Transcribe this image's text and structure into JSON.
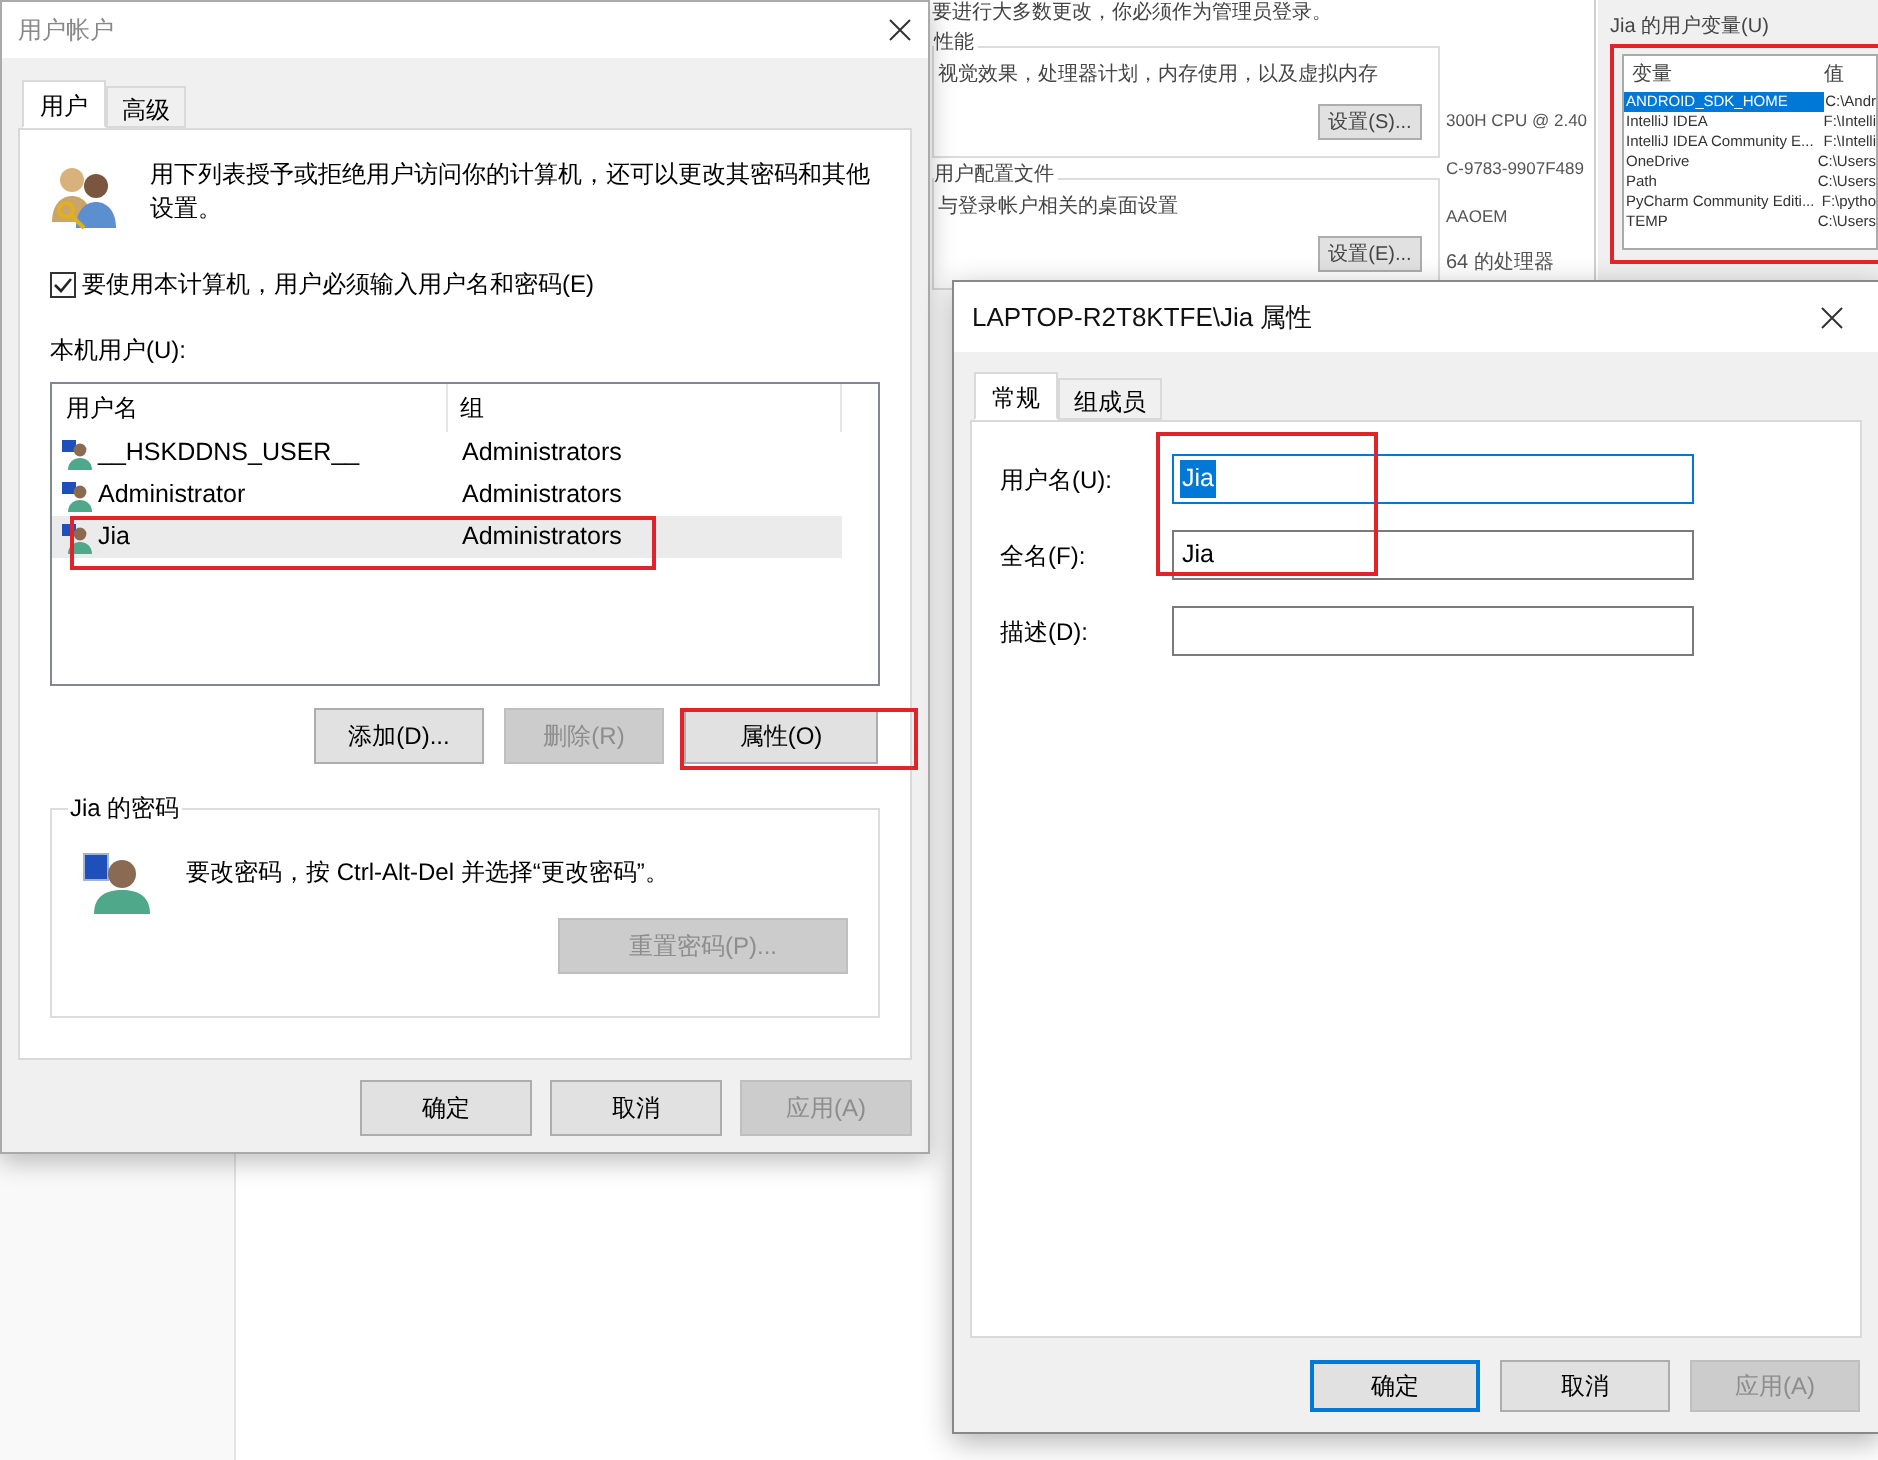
{
  "background": {
    "system_properties": {
      "notice": "要进行大多数更改，你必须作为管理员登录。",
      "performance": {
        "title": "性能",
        "text": "视觉效果，处理器计划，内存使用，以及虚拟内存",
        "button": "设置(S)..."
      },
      "profiles": {
        "title": "用户配置文件",
        "text": "与登录帐户相关的桌面设置",
        "button": "设置(E)..."
      }
    },
    "system_info": [
      "300H CPU @ 2.40",
      "C-9783-9907F489",
      "AAOEM",
      "64 的处理器"
    ],
    "env_vars": {
      "title": "Jia 的用户变量(U)",
      "columns": [
        "变量",
        "值"
      ],
      "rows": [
        {
          "name": "ANDROID_SDK_HOME",
          "value": "C:\\Andr",
          "selected": true
        },
        {
          "name": "IntelliJ IDEA",
          "value": "F:\\Intelli",
          "selected": false
        },
        {
          "name": "IntelliJ IDEA Community E...",
          "value": "F:\\Intelli",
          "selected": false
        },
        {
          "name": "OneDrive",
          "value": "C:\\Users",
          "selected": false
        },
        {
          "name": "Path",
          "value": "C:\\Users",
          "selected": false
        },
        {
          "name": "PyCharm Community Editi...",
          "value": "F:\\pytho",
          "selected": false
        },
        {
          "name": "TEMP",
          "value": "C:\\Users",
          "selected": false
        }
      ]
    }
  },
  "accounts_dialog": {
    "title": "用户帐户",
    "tabs": [
      {
        "label": "用户",
        "selected": true
      },
      {
        "label": "高级",
        "selected": false
      }
    ],
    "intro": "用下列表授予或拒绝用户访问你的计算机，还可以更改其密码和其他设置。",
    "require_password": {
      "label": "要使用本计算机，用户必须输入用户名和密码(E)",
      "checked": true
    },
    "users_label": "本机用户(U):",
    "users_table": {
      "columns": [
        "用户名",
        "组"
      ],
      "rows": [
        {
          "name": "__HSKDDNS_USER__",
          "group": "Administrators",
          "selected": false
        },
        {
          "name": "Administrator",
          "group": "Administrators",
          "selected": false
        },
        {
          "name": "Jia",
          "group": "Administrators",
          "selected": true
        }
      ]
    },
    "buttons": [
      {
        "label": "添加(D)...",
        "disabled": false
      },
      {
        "label": "删除(R)",
        "disabled": true
      },
      {
        "label": "属性(O)",
        "disabled": false
      }
    ],
    "password_group": {
      "title": "Jia 的密码",
      "text": "要改密码，按 Ctrl-Alt-Del 并选择“更改密码”。",
      "button": {
        "label": "重置密码(P)...",
        "disabled": true
      }
    },
    "footer_buttons": [
      {
        "label": "确定",
        "disabled": false,
        "default": false
      },
      {
        "label": "取消",
        "disabled": false,
        "default": false
      },
      {
        "label": "应用(A)",
        "disabled": true,
        "default": false
      }
    ]
  },
  "properties_dialog": {
    "title": "LAPTOP-R2T8KTFE\\Jia 属性",
    "tabs": [
      {
        "label": "常规",
        "selected": true
      },
      {
        "label": "组成员",
        "selected": false
      }
    ],
    "fields": [
      {
        "label": "用户名(U):",
        "value": "Jia",
        "selected": true
      },
      {
        "label": "全名(F):",
        "value": "Jia",
        "selected": false
      },
      {
        "label": "描述(D):"
      }
    ],
    "footer_buttons": [
      {
        "label": "确定",
        "disabled": false,
        "default": true
      },
      {
        "label": "取消",
        "disabled": false,
        "default": false
      },
      {
        "label": "应用(A)",
        "disabled": true,
        "default": false
      }
    ]
  }
}
